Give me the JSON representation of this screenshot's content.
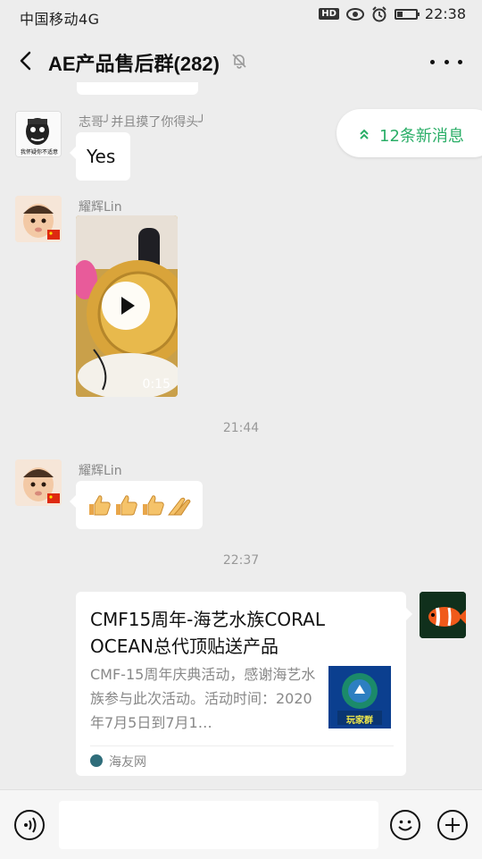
{
  "status_bar": {
    "carrier": "中国移动4G",
    "network_badge": "4G",
    "hd_badge": "HD",
    "time": "22:38",
    "battery_level": 0.3
  },
  "header": {
    "title": "AE产品售后群(282)",
    "icons": [
      "back-arrow-icon",
      "mute-bell-icon",
      "more-icon"
    ]
  },
  "new_messages_label": "12条新消息",
  "messages": [
    {
      "sender": "志哥╯并且摸了你得头╯",
      "avatar_caption": "我怀疑你不适意",
      "text": "Yes"
    },
    {
      "sender": "耀辉Lin",
      "type": "video",
      "duration": "0:15"
    },
    {
      "sender": "耀辉Lin",
      "type": "emoji",
      "emojis": [
        "thumbs-up",
        "thumbs-up",
        "thumbs-up",
        "clap"
      ]
    }
  ],
  "timestamps": [
    "21:44",
    "22:37"
  ],
  "article": {
    "title": "CMF15周年-海艺水族CORAL OCEAN总代顶贴送产品",
    "description": "CMF-15周年庆典活动，感谢海艺水族参与此次活动。活动时间：2020年7月5日到7月1…",
    "thumb_text": "玩家群",
    "source": "海友网"
  },
  "colors": {
    "accent": "#2aae67",
    "background": "#ededed",
    "bubble": "#ffffff"
  }
}
